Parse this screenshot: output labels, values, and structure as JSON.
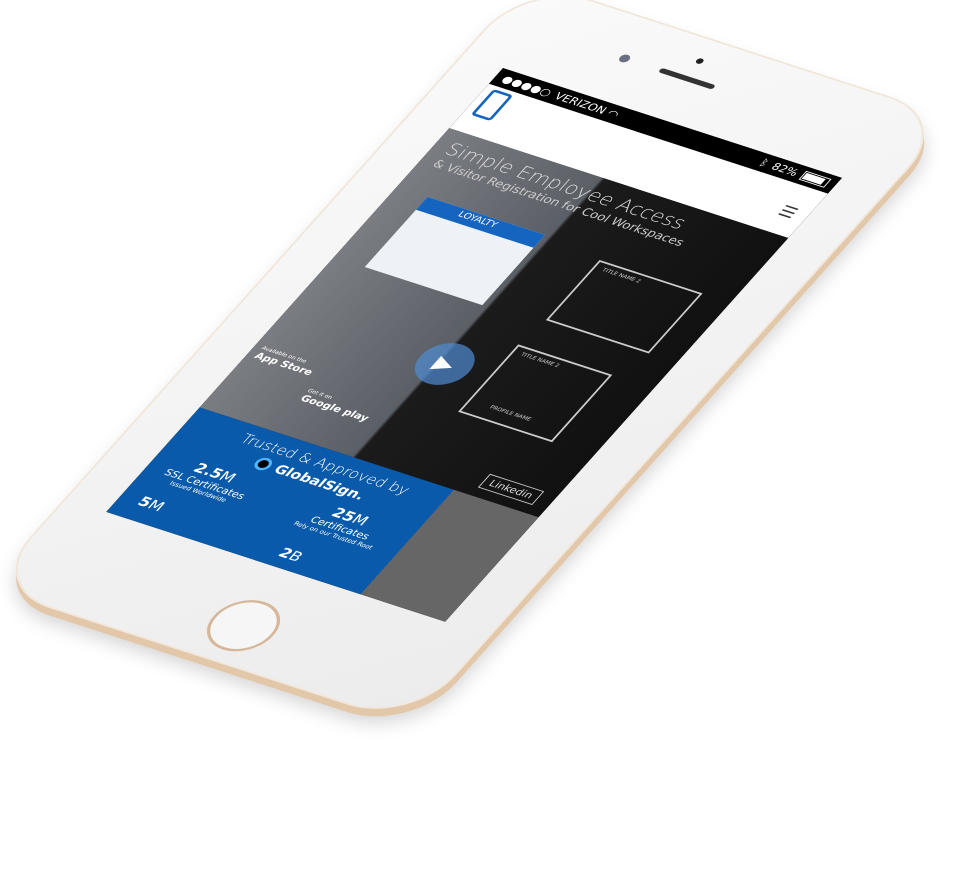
{
  "status_bar": {
    "signal_dots": 5,
    "carrier": "VERIZON",
    "battery": "82%"
  },
  "hero": {
    "title": "Simple Employee Access",
    "subtitle": "& Visitor Registration for Cool Workspaces"
  },
  "app_preview": {
    "label": "LOYALTY"
  },
  "wireframes": [
    {
      "title": "TITLE NAME 2"
    },
    {
      "title": "TITLE NAME 2",
      "caption": "PROFILE NAME"
    }
  ],
  "stores": {
    "apple_small": "Available on the",
    "apple": "App Store",
    "google_small": "Get it on",
    "google": "Google play"
  },
  "linkedin": "Linkedin",
  "trust": {
    "heading": "Trusted & Approved by",
    "brand": "GlobalSign."
  },
  "stats": [
    {
      "value": "2.5",
      "unit": "M",
      "label": "SSL Certificates",
      "sub": "Issued Worldwide"
    },
    {
      "value": "25",
      "unit": "M",
      "label": "Certificates",
      "sub": "Rely on our Trusted Root"
    },
    {
      "value": "5",
      "unit": "M"
    },
    {
      "value": "2",
      "unit": "B"
    }
  ],
  "colors": {
    "brand_blue": "#0a5aab",
    "gold_edge": "#d7b79a"
  }
}
